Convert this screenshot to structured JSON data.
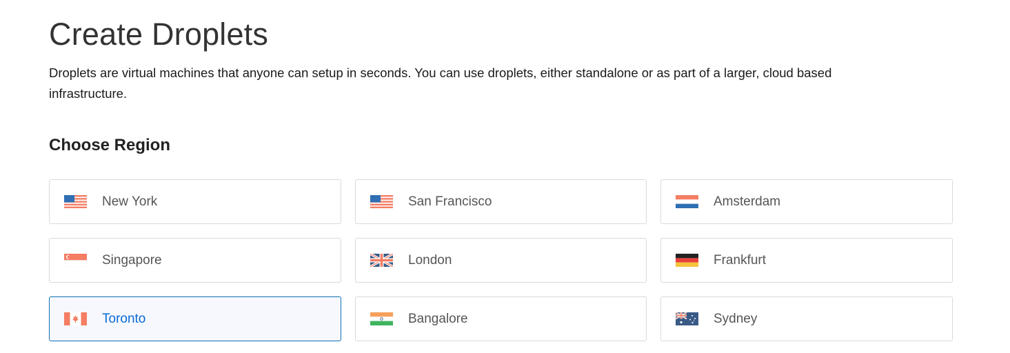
{
  "page": {
    "title": "Create Droplets",
    "description": "Droplets are virtual machines that anyone can setup in seconds. You can use droplets, either standalone or as part of a larger, cloud based infrastructure."
  },
  "region_section": {
    "heading": "Choose Region",
    "selected_region": "Toronto",
    "regions": [
      {
        "label": "New York",
        "flag_icon": "us-flag-icon"
      },
      {
        "label": "San Francisco",
        "flag_icon": "us-flag-icon"
      },
      {
        "label": "Amsterdam",
        "flag_icon": "netherlands-flag-icon"
      },
      {
        "label": "Singapore",
        "flag_icon": "singapore-flag-icon"
      },
      {
        "label": "London",
        "flag_icon": "uk-flag-icon"
      },
      {
        "label": "Frankfurt",
        "flag_icon": "germany-flag-icon"
      },
      {
        "label": "Toronto",
        "flag_icon": "canada-flag-icon"
      },
      {
        "label": "Bangalore",
        "flag_icon": "india-flag-icon"
      },
      {
        "label": "Sydney",
        "flag_icon": "australia-flag-icon"
      }
    ]
  },
  "colors": {
    "selected_border": "#0e6fb5",
    "selected_text": "#0b6ad6",
    "selected_background": "#f6f8fd",
    "card_border": "#d9d9d9"
  }
}
